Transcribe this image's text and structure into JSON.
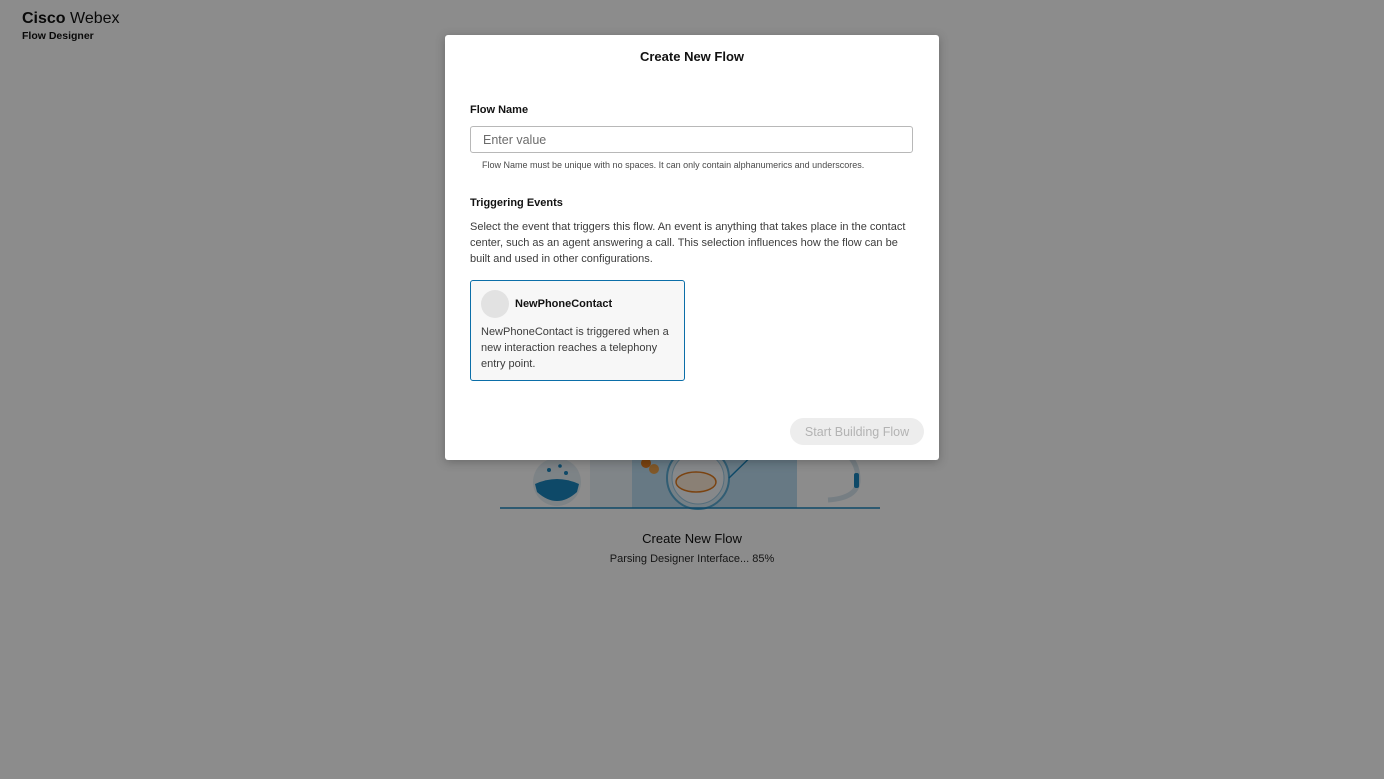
{
  "app": {
    "brand": "Cisco",
    "product": "Webex",
    "subtitle": "Flow Designer"
  },
  "loader": {
    "title": "Create New Flow",
    "status": "Parsing Designer Interface... 85%",
    "progress_percent": 85
  },
  "modal": {
    "title": "Create New Flow",
    "flow_name": {
      "label": "Flow Name",
      "placeholder": "Enter value",
      "value": "",
      "helper": "Flow Name must be unique with no spaces. It can only contain alphanumerics and underscores."
    },
    "triggering_events": {
      "label": "Triggering Events",
      "description": "Select the event that triggers this flow. An event is anything that takes place in the contact center, such as an agent answering a call. This selection influences how the flow can be built and used in other configurations.",
      "events": [
        {
          "name": "NewPhoneContact",
          "description": "NewPhoneContact is triggered when a new interaction reaches a telephony entry point.",
          "selected": true
        }
      ]
    },
    "start_button": {
      "label": "Start Building Flow",
      "enabled": false
    }
  },
  "colors": {
    "overlay": "#000000",
    "selected_border": "#0b6ea8",
    "accent_blue": "#0f8fc7",
    "accent_orange": "#e07b1f"
  }
}
